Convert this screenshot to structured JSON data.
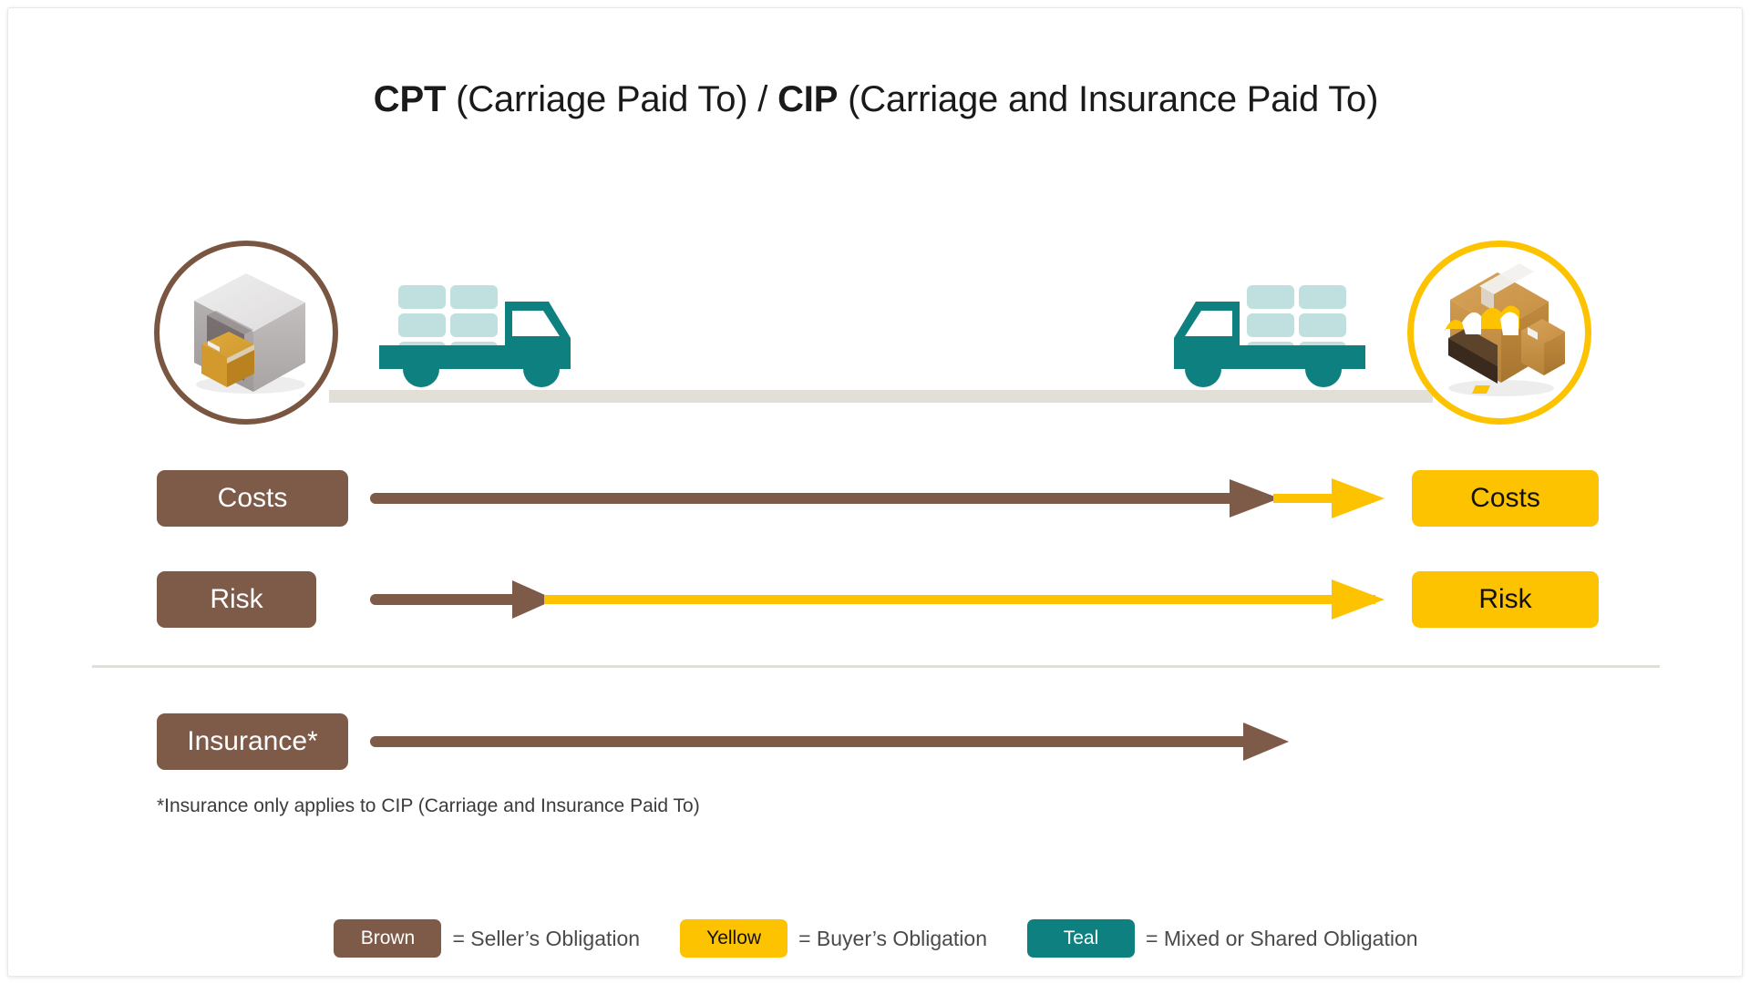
{
  "title": {
    "code1": "CPT",
    "expansion1": " (Carriage Paid To) / ",
    "code2": "CIP",
    "expansion2": " (Carriage and Insurance Paid To)"
  },
  "colors": {
    "brown": "#7E5A48",
    "brown_dark": "#7a5642",
    "yellow": "#FDC300",
    "teal": "#0F8080",
    "teal_light": "#BFE0DF",
    "road": "#e2dfd8",
    "divider": "#e0ded8"
  },
  "scene": {
    "origin_node": "warehouse-icon",
    "origin_ring_color": "#7a5642",
    "destination_node": "store-icon",
    "destination_ring_color": "#FDC300",
    "truck_outbound": "truck-icon-right",
    "truck_inbound": "truck-icon-left",
    "road": "road-line"
  },
  "rows": [
    {
      "id": "costs",
      "left_label": "Costs",
      "right_label": "Costs",
      "left_chip_color": "#7E5A48",
      "right_chip_color": "#FDC300",
      "brown_segment_end_pct": 77,
      "yellow_segment": true
    },
    {
      "id": "risk",
      "left_label": "Risk",
      "right_label": "Risk",
      "left_chip_color": "#7E5A48",
      "right_chip_color": "#FDC300",
      "brown_segment_end_pct": 18,
      "yellow_segment": true
    },
    {
      "id": "insurance",
      "left_label": "Insurance*",
      "right_label": null,
      "left_chip_color": "#7E5A48",
      "right_chip_color": null,
      "brown_segment_end_pct": 100,
      "yellow_segment": false
    }
  ],
  "footnote": "*Insurance only applies to CIP (Carriage and Insurance Paid To)",
  "legend": {
    "items": [
      {
        "chip": "Brown",
        "text": "= Seller’s Obligation",
        "color": "#7E5A48"
      },
      {
        "chip": "Yellow",
        "text": "= Buyer’s Obligation",
        "color": "#FDC300"
      },
      {
        "chip": "Teal",
        "text": "= Mixed or Shared Obligation",
        "color": "#0F8080"
      }
    ]
  }
}
